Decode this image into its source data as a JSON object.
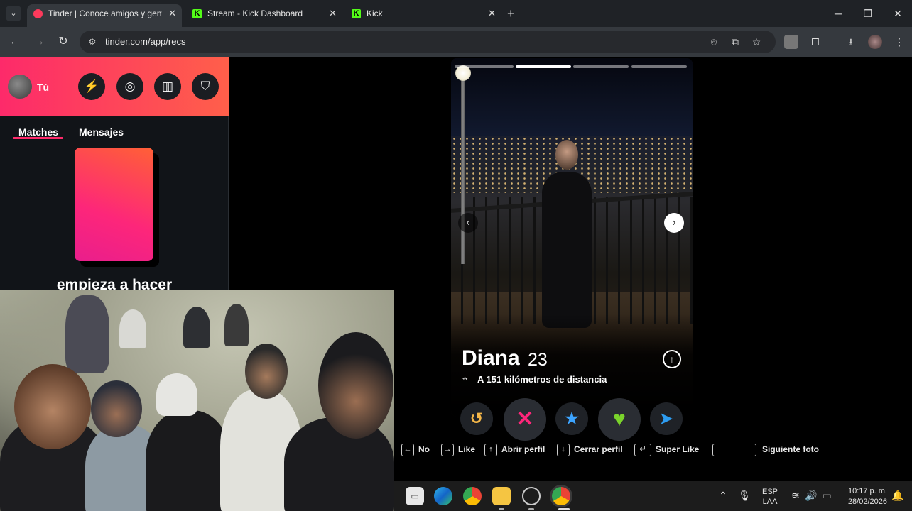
{
  "browser": {
    "tabs": [
      {
        "title": "Tinder | Conoce amigos y gente",
        "active": true
      },
      {
        "title": "Stream - Kick Dashboard",
        "active": false
      },
      {
        "title": "Kick",
        "active": false
      }
    ],
    "url": "tinder.com/app/recs"
  },
  "sidebar": {
    "me_label": "Tú",
    "tabs": [
      "Matches",
      "Mensajes"
    ],
    "cta": "empieza a hacer"
  },
  "card": {
    "name": "Diana",
    "age": "23",
    "distance": "A 151 kilómetros de distancia",
    "photo_count": 4,
    "current_photo": 2
  },
  "shortcuts": [
    {
      "key": "←",
      "label": "No"
    },
    {
      "key": "→",
      "label": "Like"
    },
    {
      "key": "↑",
      "label": "Abrir perfil"
    },
    {
      "key": "↓",
      "label": "Cerrar perfil"
    },
    {
      "key": "↵",
      "label": "Super Like"
    },
    {
      "key": "",
      "label": "Siguiente foto"
    }
  ],
  "taskbar": {
    "lang_line1": "ESP",
    "lang_line2": "LAA",
    "time": "10:17 p. m.",
    "date": "28/02/2026"
  },
  "colors": {
    "tinder_gradient_start": "#fd2a6a",
    "tinder_gradient_end": "#ff5f4a",
    "rewind": "#f5b748",
    "nope": "#fd267a",
    "superlike": "#3ca4ff",
    "like": "#7ad32b",
    "boost": "#2d9cf0"
  }
}
